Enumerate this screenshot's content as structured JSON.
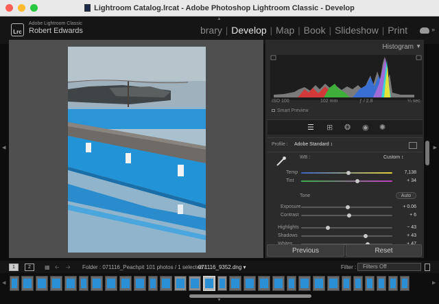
{
  "window": {
    "title": "Lightroom Catalog.lrcat - Adobe Photoshop Lightroom Classic - Develop"
  },
  "identity": {
    "logo_text": "Lrc",
    "app_name": "Adobe Lightroom Classic",
    "user_name": "Robert Edwards"
  },
  "modules": [
    "brary",
    "Develop",
    "Map",
    "Book",
    "Slideshow",
    "Print"
  ],
  "active_module": "Develop",
  "histogram": {
    "title": "Histogram",
    "iso": "ISO 100",
    "focal_length": "102 mm",
    "aperture": "ƒ / 2.8",
    "shutter": "¼ sec",
    "smart_preview": "Smart Preview"
  },
  "profile": {
    "label": "Profile :",
    "value": "Adobe Standard ↕"
  },
  "white_balance": {
    "label": "WB :",
    "value": "Custom ↕",
    "temp": {
      "label": "Temp",
      "value": "7,138",
      "level": 0.52
    },
    "tint": {
      "label": "Tint",
      "value": "+ 34",
      "level": 0.62
    }
  },
  "tone": {
    "label": "Tone",
    "auto_label": "Auto",
    "sliders": [
      {
        "label": "Exposure",
        "value": "+ 0.06",
        "level": 0.51
      },
      {
        "label": "Contrast",
        "value": "+ 6",
        "level": 0.53
      },
      {
        "label": "Highlights",
        "value": "− 43",
        "level": 0.29
      },
      {
        "label": "Shadows",
        "value": "+ 43",
        "level": 0.71
      },
      {
        "label": "Whites",
        "value": "+ 47",
        "level": 0.73
      }
    ]
  },
  "buttons": {
    "previous": "Previous",
    "reset": "Reset"
  },
  "filmstrip_bar": {
    "view1": "1",
    "view2": "2",
    "folder": "Folder : 071116_Peachpit",
    "count": "101 photos / 1 selected /",
    "filename": "071116_9352.dng ▾",
    "filter_label": "Filter :",
    "filter_value": "Filters Off"
  },
  "colors": {
    "accent_blue": "#2b8fd6",
    "panel_bg": "#2b2b2b",
    "canvas_bg": "#4f4f4f"
  }
}
